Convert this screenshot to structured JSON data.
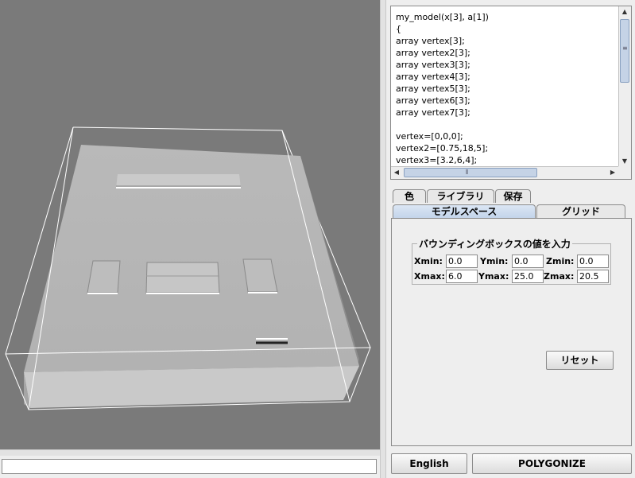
{
  "code_editor": {
    "lines": [
      "my_model(x[3], a[1])",
      "{",
      "array vertex[3];",
      "array vertex2[3];",
      "array vertex3[3];",
      "array vertex4[3];",
      "array vertex5[3];",
      "array vertex6[3];",
      "array vertex7[3];",
      "",
      "vertex=[0,0,0];",
      "vertex2=[0.75,18,5];",
      "vertex3=[3.2,6,4];"
    ]
  },
  "tabs": {
    "row1": [
      "色",
      "ライブラリ",
      "保存"
    ],
    "row2": [
      "モデルスペース",
      "グリッド"
    ],
    "active": "モデルスペース"
  },
  "bounds": {
    "title": "バウンディングボックスの値を入力",
    "xmin_label": "Xmin:",
    "xmin": "0.0",
    "ymin_label": "Ymin:",
    "ymin": "0.0",
    "zmin_label": "Zmin:",
    "zmin": "0.0",
    "xmax_label": "Xmax:",
    "xmax": "6.0",
    "ymax_label": "Ymax:",
    "ymax": "25.0",
    "zmax_label": "Zmax:",
    "zmax": "20.5"
  },
  "buttons": {
    "reset": "リセット",
    "english": "English",
    "polygonize": "POLYGONIZE"
  },
  "status_field": {
    "value": ""
  },
  "colors": {
    "viewport_bg": "#7a7a7a",
    "tab_active": "#c3d4ea",
    "thumb": "#c5d3e6"
  }
}
